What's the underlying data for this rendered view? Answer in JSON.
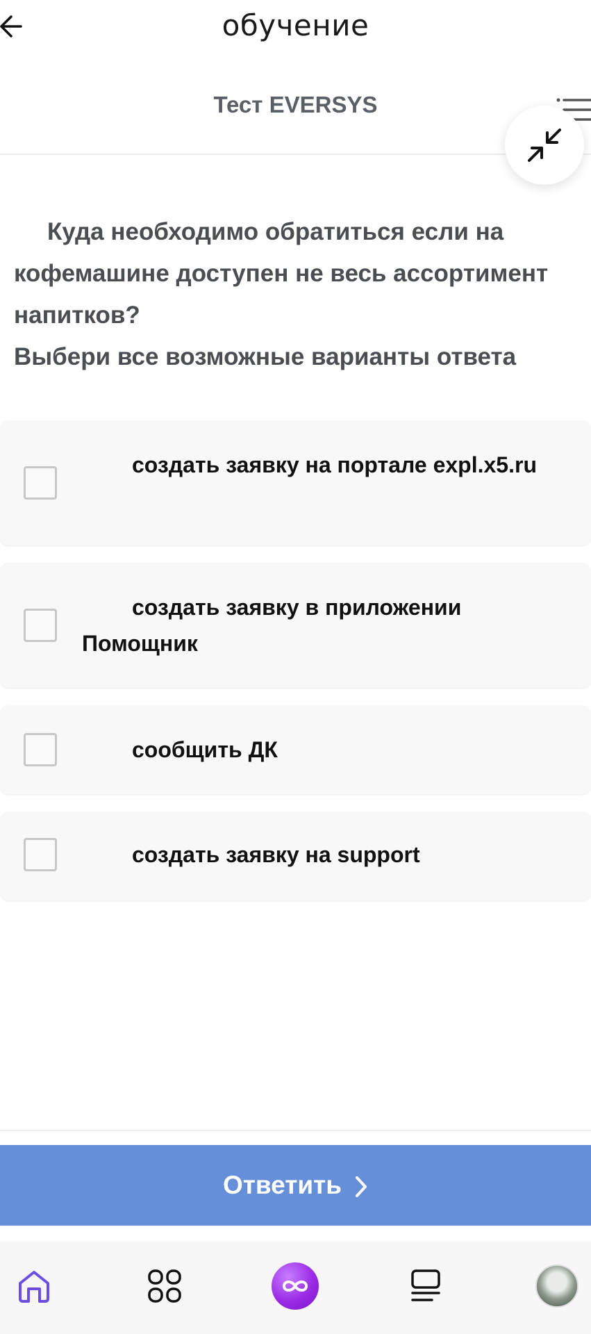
{
  "header": {
    "app_title": "обучение",
    "test_title": "Тест EVERSYS"
  },
  "question": {
    "text": "Куда необходимо обратиться если на кофемашине доступен не весь ассортимент напитков?",
    "hint": "Выбери все возможные варианты ответа"
  },
  "options": [
    {
      "label": "создать заявку на портале expl.x5.ru",
      "checked": false
    },
    {
      "label": "создать заявку в приложении Помощник",
      "checked": false
    },
    {
      "label": "сообщить ДК",
      "checked": false
    },
    {
      "label": "создать заявку на support",
      "checked": false
    }
  ],
  "submit": {
    "label": "Ответить"
  },
  "nav": {
    "items": [
      "home-icon",
      "apps-grid-icon",
      "infinity-icon",
      "feed-icon",
      "avatar"
    ]
  },
  "colors": {
    "accent": "#6590d9",
    "nav_active": "#6a4fe0",
    "infinity": "#9b2be6"
  }
}
